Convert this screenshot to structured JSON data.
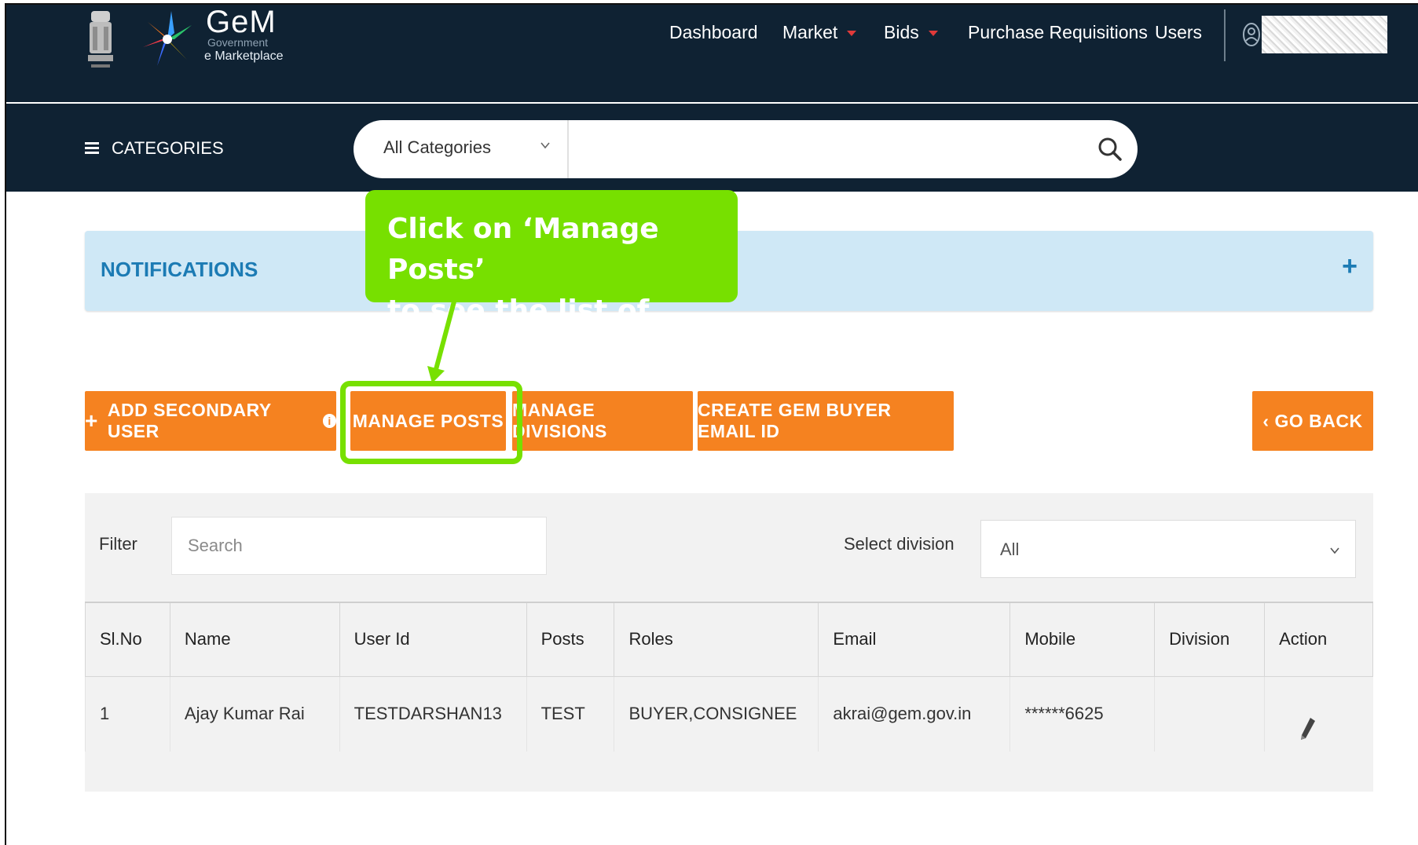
{
  "brand": {
    "title": "GeM",
    "subtitle_line1": "Government",
    "subtitle_line2": "e Marketplace"
  },
  "nav": {
    "dashboard": "Dashboard",
    "market": "Market",
    "bids": "Bids",
    "purchase_requisitions": "Purchase Requisitions",
    "users": "Users"
  },
  "catbar": {
    "categories_label": "CATEGORIES",
    "category_select": "All Categories"
  },
  "notifications": {
    "title": "NOTIFICATIONS",
    "expand": "+"
  },
  "callout": {
    "line1": "Click on ‘Manage Posts’",
    "line2": "to see the list of users."
  },
  "actions": {
    "add_secondary_user": "ADD SECONDARY USER",
    "manage_posts": "MANAGE POSTS",
    "manage_divisions": "MANAGE DIVISIONS",
    "create_email": "CREATE GEM BUYER EMAIL ID",
    "go_back": "‹ GO BACK"
  },
  "filter": {
    "label": "Filter",
    "placeholder": "Search",
    "division_label": "Select division",
    "division_value": "All"
  },
  "table": {
    "headers": [
      "Sl.No",
      "Name",
      "User Id",
      "Posts",
      "Roles",
      "Email",
      "Mobile",
      "Division",
      "Action"
    ],
    "rows": [
      {
        "sl": "1",
        "name": "Ajay Kumar Rai",
        "user_id": "TESTDARSHAN13",
        "posts": "TEST",
        "roles": "BUYER,CONSIGNEE",
        "email": "akrai@gem.gov.in",
        "mobile": "******6625",
        "division": ""
      }
    ]
  },
  "colors": {
    "header_bg": "#0f2233",
    "accent_orange": "#f58220",
    "callout_green": "#77e000",
    "notif_bg": "#cfe8f6",
    "notif_text": "#1c7bb4"
  }
}
